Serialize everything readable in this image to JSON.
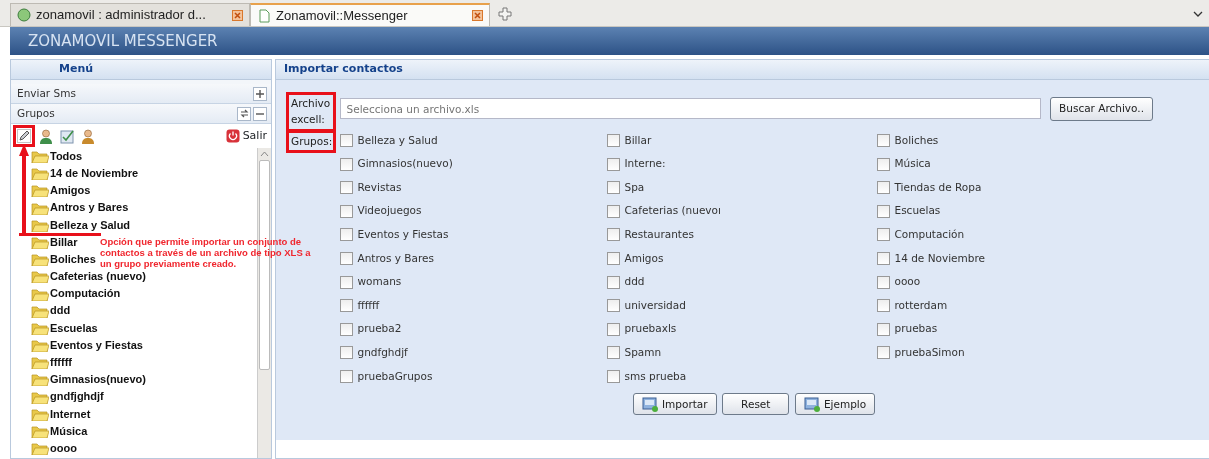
{
  "browser_tabs": [
    {
      "label": "zonamovil : administrador d...",
      "selected": false
    },
    {
      "label": "Zonamovil::Messenger",
      "selected": true
    }
  ],
  "app_title": "ZONAMOVIL MESSENGER",
  "sidebar": {
    "title": "Menú",
    "sections": [
      {
        "label": "Enviar Sms",
        "kind": "collapsed"
      },
      {
        "label": "Grupos",
        "kind": "expanded"
      }
    ],
    "toolbar": {
      "edit_highlighted": true,
      "exit_label": "Salir"
    },
    "tree": [
      "Todos",
      "14 de Noviembre",
      "Amigos",
      "Antros y Bares",
      "Belleza y Salud",
      "Billar",
      "Boliches",
      "Cafeterias (nuevo)",
      "Computación",
      "ddd",
      "Escuelas",
      "Eventos y Fiestas",
      "ffffff",
      "Gimnasios(nuevo)",
      "gndfjghdjf",
      "Internet",
      "Música",
      "oooo"
    ]
  },
  "main": {
    "title": "Importar contactos",
    "file_label": {
      "text": "Archivo excell:",
      "highlighted": true
    },
    "file_placeholder": "Selecciona un archivo.xls",
    "browse_button": "Buscar Archivo..",
    "groups_label": {
      "text": "Grupos:",
      "highlighted": true
    },
    "groups": [
      {
        "label": "Belleza y Salud",
        "checked": false
      },
      {
        "label": "Billar",
        "checked": false
      },
      {
        "label": "Boliches",
        "checked": false
      },
      {
        "label": "Gimnasios(nuevo)",
        "checked": false
      },
      {
        "label": "Interne:",
        "checked": false
      },
      {
        "label": "Música",
        "checked": false
      },
      {
        "label": "Revistas",
        "checked": false
      },
      {
        "label": "Spa",
        "checked": false
      },
      {
        "label": "Tiendas de Ropa",
        "checked": false
      },
      {
        "label": "Videojuegos",
        "checked": false
      },
      {
        "label": "Cafeterias (nuevoı",
        "checked": false
      },
      {
        "label": "Escuelas",
        "checked": false
      },
      {
        "label": "Eventos y Fiestas",
        "checked": false
      },
      {
        "label": "Restaurantes",
        "checked": false
      },
      {
        "label": "Computación",
        "checked": false
      },
      {
        "label": "Antros y Bares",
        "checked": false
      },
      {
        "label": "Amigos",
        "checked": false
      },
      {
        "label": "14 de Noviembre",
        "checked": false
      },
      {
        "label": "womans",
        "checked": false
      },
      {
        "label": "ddd",
        "checked": false
      },
      {
        "label": "oooo",
        "checked": false
      },
      {
        "label": "ffffff",
        "checked": false
      },
      {
        "label": "universidad",
        "checked": false
      },
      {
        "label": "rotterdam",
        "checked": false
      },
      {
        "label": "prueba2",
        "checked": false
      },
      {
        "label": "pruebaxls",
        "checked": false
      },
      {
        "label": "pruebas",
        "checked": false
      },
      {
        "label": "gndfghdjf",
        "checked": false
      },
      {
        "label": "Spamn",
        "checked": false
      },
      {
        "label": "pruebaSimon",
        "checked": false
      },
      {
        "label": "pruebaGrupos",
        "checked": false
      },
      {
        "label": "sms prueba",
        "checked": false
      }
    ],
    "buttons": [
      {
        "label": "Importar",
        "kind": "icon"
      },
      {
        "label": "Reset",
        "kind": "plain"
      },
      {
        "label": "Ejemplo",
        "kind": "icon"
      }
    ]
  },
  "annotation": {
    "text": "Opción que permite importar un conjunto de contactos a través de un archivo de tipo XLS a un grupo previamente creado."
  }
}
